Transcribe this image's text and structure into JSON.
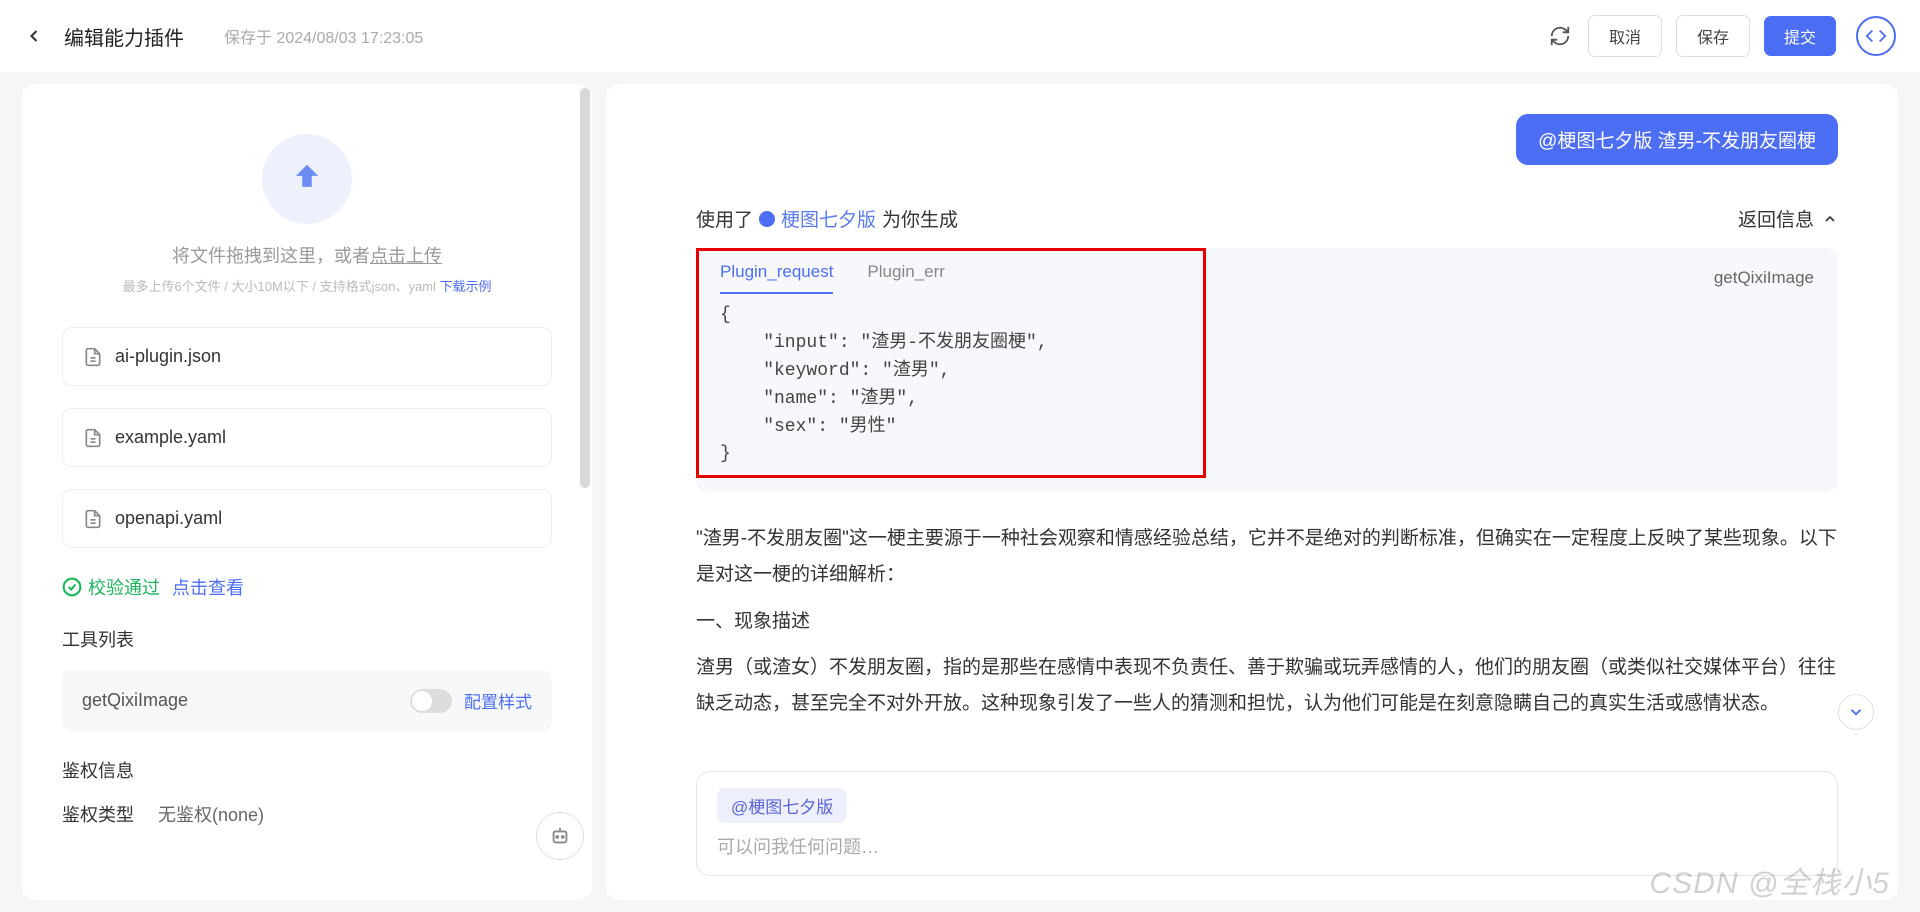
{
  "header": {
    "title": "编辑能力插件",
    "saved": "保存于 2024/08/03 17:23:05",
    "cancel": "取消",
    "save": "保存",
    "submit": "提交"
  },
  "upload": {
    "drag_text": "将文件拖拽到这里，或者",
    "click_upload": "点击上传",
    "hint": "最多上传6个文件 / 大小10M以下 / 支持格式json、yaml ",
    "download_sample": "下载示例"
  },
  "files": [
    {
      "name": "ai-plugin.json"
    },
    {
      "name": "example.yaml"
    },
    {
      "name": "openapi.yaml"
    }
  ],
  "validate": {
    "pass": "校验通过",
    "view": "点击查看"
  },
  "tools": {
    "title": "工具列表",
    "items": [
      {
        "name": "getQixiImage",
        "config": "配置样式"
      }
    ]
  },
  "auth": {
    "title": "鉴权信息",
    "type_label": "鉴权类型",
    "type_value": "无鉴权(none)"
  },
  "chat": {
    "user_message": "@梗图七夕版  渣男-不发朋友圈梗",
    "used_prefix": "使用了",
    "plugin_name": "梗图七夕版",
    "gen_suffix": "为你生成",
    "return_info": "返回信息",
    "tabs": {
      "request": "Plugin_request",
      "err": "Plugin_err"
    },
    "func_name": "getQixiImage",
    "code": "{\n    \"input\": \"渣男-不发朋友圈梗\",\n    \"keyword\": \"渣男\",\n    \"name\": \"渣男\",\n    \"sex\": \"男性\"\n}",
    "answer_p1": "\"渣男-不发朋友圈\"这一梗主要源于一种社会观察和情感经验总结，它并不是绝对的判断标准，但确实在一定程度上反映了某些现象。以下是对这一梗的详细解析：",
    "answer_h1": "一、现象描述",
    "answer_p2": "渣男（或渣女）不发朋友圈，指的是那些在感情中表现不负责任、善于欺骗或玩弄感情的人，他们的朋友圈（或类似社交媒体平台）往往缺乏动态，甚至完全不对外开放。这种现象引发了一些人的猜测和担忧，认为他们可能是在刻意隐瞒自己的真实生活或感情状态。"
  },
  "input": {
    "mention": "@梗图七夕版",
    "placeholder": "可以问我任何问题…"
  },
  "watermark": "CSDN @全栈小5"
}
